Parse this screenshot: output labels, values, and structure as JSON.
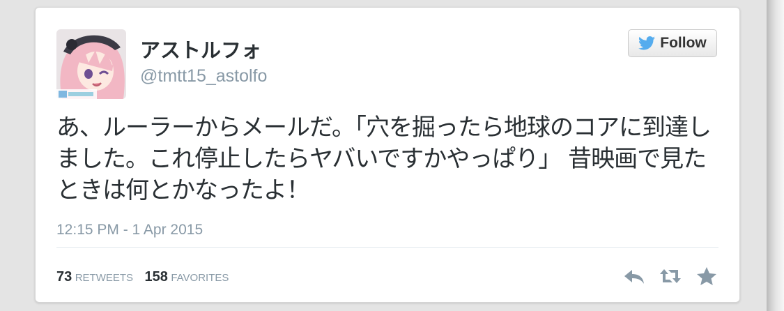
{
  "tweet": {
    "display_name": "アストルフォ",
    "handle": "@tmtt15_astolfo",
    "follow_label": "Follow",
    "text": "あ、ルーラーからメールだ。「穴を掘ったら地球のコアに到達しました。これ停止したらヤバいですかやっぱり」 昔映画で見たときは何とかなったよ！",
    "timestamp": "12:15 PM - 1 Apr 2015",
    "retweets_count": "73",
    "retweets_label": "Retweets",
    "favorites_count": "158",
    "favorites_label": "Favorites"
  },
  "icons": {
    "follow": "twitter-bird-icon",
    "reply": "reply-icon",
    "retweet": "retweet-icon",
    "favorite": "star-icon"
  },
  "colors": {
    "twitter_blue": "#55acee",
    "action_gray": "#8899a6",
    "text": "#292f33"
  }
}
